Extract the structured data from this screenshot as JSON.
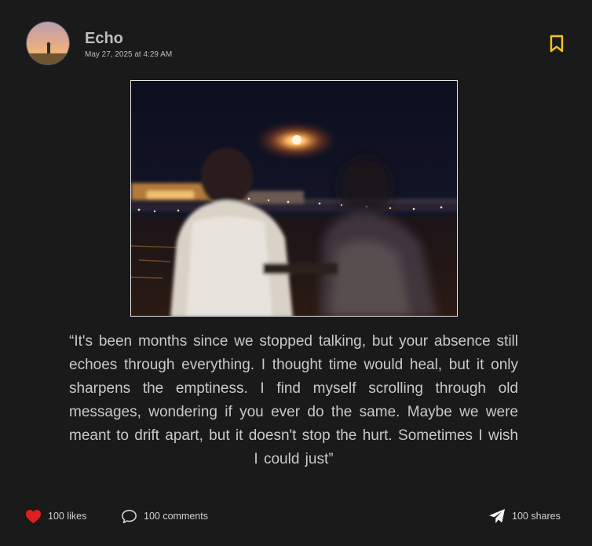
{
  "post": {
    "author": "Echo",
    "date": "May 27, 2025 at 4:29 AM",
    "quote": "“It's been months since we stopped talking, but your absence still echoes through everything. I thought time would heal, but it only sharpens the emptiness. I find myself scrolling through old messages, wondering if you ever do the same. Maybe we were meant to drift apart, but it doesn't stop the hurt. Sometimes I wish I could just”"
  },
  "actions": {
    "likes": "100 likes",
    "comments": "100 comments",
    "shares": "100 shares"
  },
  "icons": {
    "bookmark": "bookmark-icon",
    "like": "heart-icon",
    "comment": "comment-icon",
    "share": "paper-plane-icon"
  },
  "colors": {
    "background": "#1a1a1a",
    "bookmark": "#f5c518",
    "heart": "#e0201e"
  }
}
